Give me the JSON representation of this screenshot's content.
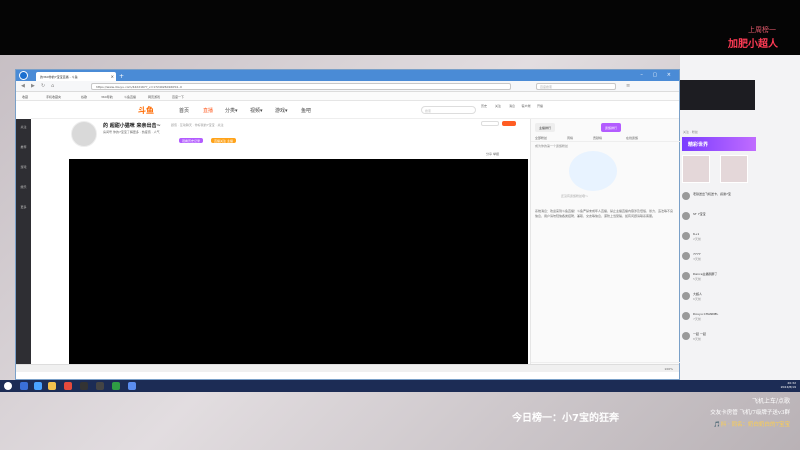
{
  "overlay": {
    "top_small": "上周榜一",
    "top_big": "加肥小超人",
    "bottom_title": "今日榜一：小7宝的狂奔",
    "right_lines": [
      "飞机上车/点歌",
      "交友卡房管 飞机/7级牌子送v3群",
      "🎵抖 · 同名：奶白奶白的7宝宝"
    ]
  },
  "browser": {
    "tab_title": "的360你的7宝宝直播 - 斗鱼",
    "url": "https://www.douyu.com/4422167?_v=1724026016054..0",
    "search_placeholder": "百度搜索",
    "bookmarks": [
      "收藏",
      "手机收藏夹",
      "谷歌",
      "360导航",
      "斗鱼直播",
      "网页游戏",
      "百度一下"
    ],
    "status_left": "",
    "status_right": "100%"
  },
  "site": {
    "logo": "斗鱼",
    "nav": [
      "首页",
      "直播",
      "分类▾",
      "视频▾",
      "游戏▾",
      "鱼吧"
    ],
    "search_placeholder": "搜索",
    "header_icons": [
      "历史",
      "关注",
      "消息",
      "客户端",
      "开播"
    ],
    "rail": [
      "关注",
      "推荐",
      "游戏",
      "娱乐",
      "更多"
    ]
  },
  "room": {
    "title": "的 超甜小猫咪 来亲出击~",
    "tags": "颜值 · 互动聊天 · 你好我的7宝宝 · 关注",
    "meta": "房间号 你的7宝宝了解更多 · 热度值 · 人气",
    "badge1": "观看历史记录",
    "badge2": "直播关注 主播",
    "controls": [
      "分享",
      "举报",
      "客户端"
    ]
  },
  "sidepanel": {
    "tabs": [
      "主播排行",
      "贵族排行"
    ],
    "subtabs": [
      "全部粉丝",
      "周榜",
      "贡献榜",
      "在线贵族"
    ],
    "note_label": "成为你的第一个贵族粉丝",
    "empty_text": "还没有贵族粉丝哦～",
    "notice": "系统消息：欢迎来到斗鱼直播！斗鱼严禁未成年人直播，禁止主播直播内容涉及低俗、暴力、违法等不良信息，用户请勿轻信各类招聘、兼职、交友等信息，谨防上当受骗，如有问题请联系客服。",
    "bottom": "粉丝团  背包  我的财富"
  },
  "chat": {
    "banner": "精彩世界",
    "bar": "关注 · 粉丝",
    "items": [
      {
        "name": "老铁送出飞机送卡，感谢7宝",
        "sub": ""
      },
      {
        "name": "ST 7宝宝",
        "sub": ""
      },
      {
        "name": "6+1",
        "sub": "2天前"
      },
      {
        "name": "7777",
        "sub": "3天前"
      },
      {
        "name": "Dance主播刷屏了",
        "sub": "5天前"
      },
      {
        "name": "大超人",
        "sub": "6天前"
      },
      {
        "name": "Douyu CHANNEL",
        "sub": "7天前"
      },
      {
        "name": "一起 一起",
        "sub": "8天前"
      }
    ]
  },
  "taskbar": {
    "time": "20:32",
    "date": "2024/8/19"
  },
  "colors": {
    "accent": "#ff5d23",
    "browser_blue": "#4a8bd6",
    "taskbar": "#1c2c55",
    "overlay_red": "#ff3b55"
  }
}
